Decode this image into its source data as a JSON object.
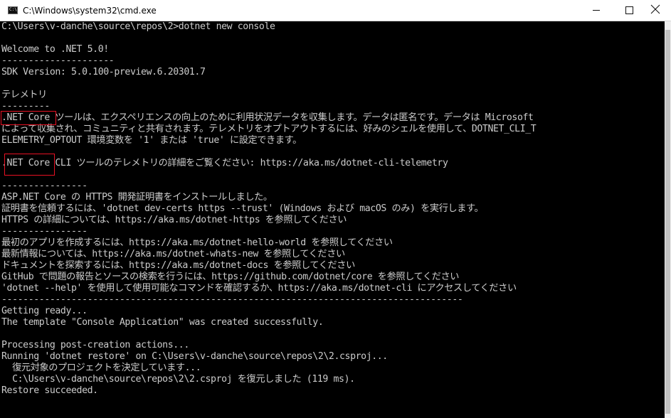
{
  "window": {
    "title": "C:\\Windows\\system32\\cmd.exe",
    "icon_label": "C:\\",
    "icon": "cmd-icon",
    "controls": [
      "minimize-icon",
      "maximize-icon",
      "close-icon"
    ]
  },
  "console": {
    "lines": [
      "C:\\Users\\v-danche\\source\\repos\\2>dotnet new console",
      "",
      "Welcome to .NET 5.0!",
      "---------------------",
      "SDK Version: 5.0.100-preview.6.20301.7",
      "",
      "テレメトリ",
      "---------",
      ".NET Core ツールは、エクスペリエンスの向上のために利用状況データを収集します。データは匿名です。データは Microsoft",
      "によって収集され、コミュニティと共有されます。テレメトリをオプトアウトするには、好みのシェルを使用して、DOTNET_CLI_T",
      "ELEMETRY_OPTOUT 環境変数を '1' または 'true' に設定できます。",
      "",
      ".NET Core CLI ツールのテレメトリの詳細をご覧ください: https://aka.ms/dotnet-cli-telemetry",
      "",
      "----------------",
      "ASP.NET Core の HTTPS 開発証明書をインストールしました。",
      "証明書を信頼するには、'dotnet dev-certs https --trust' (Windows および macOS のみ) を実行します。",
      "HTTPS の詳細については、https://aka.ms/dotnet-https を参照してください",
      "----------------",
      "最初のアプリを作成するには、https://aka.ms/dotnet-hello-world を参照してください",
      "最新情報については、https://aka.ms/dotnet-whats-new を参照してください",
      "ドキュメントを探索するには、https://aka.ms/dotnet-docs を参照してください",
      "GitHub で問題の報告とソースの検索を行うには、https://github.com/dotnet/core を参照してください",
      "'dotnet --help' を使用して使用可能なコマンドを確認するか、https://aka.ms/dotnet-cli にアクセスしてください",
      "--------------------------------------------------------------------------------------",
      "Getting ready...",
      "The template \"Console Application\" was created successfully.",
      "",
      "Processing post-creation actions...",
      "Running 'dotnet restore' on C:\\Users\\v-danche\\source\\repos\\2\\2.csproj...",
      "  復元対象のプロジェクトを決定しています...",
      "  C:\\Users\\v-danche\\source\\repos\\2\\2.csproj を復元しました (119 ms).",
      "Restore succeeded."
    ]
  },
  "colors": {
    "console_background": "#000000",
    "console_text": "#cccccc",
    "highlight_border": "#e81123",
    "titlebar_background": "#ffffff"
  }
}
